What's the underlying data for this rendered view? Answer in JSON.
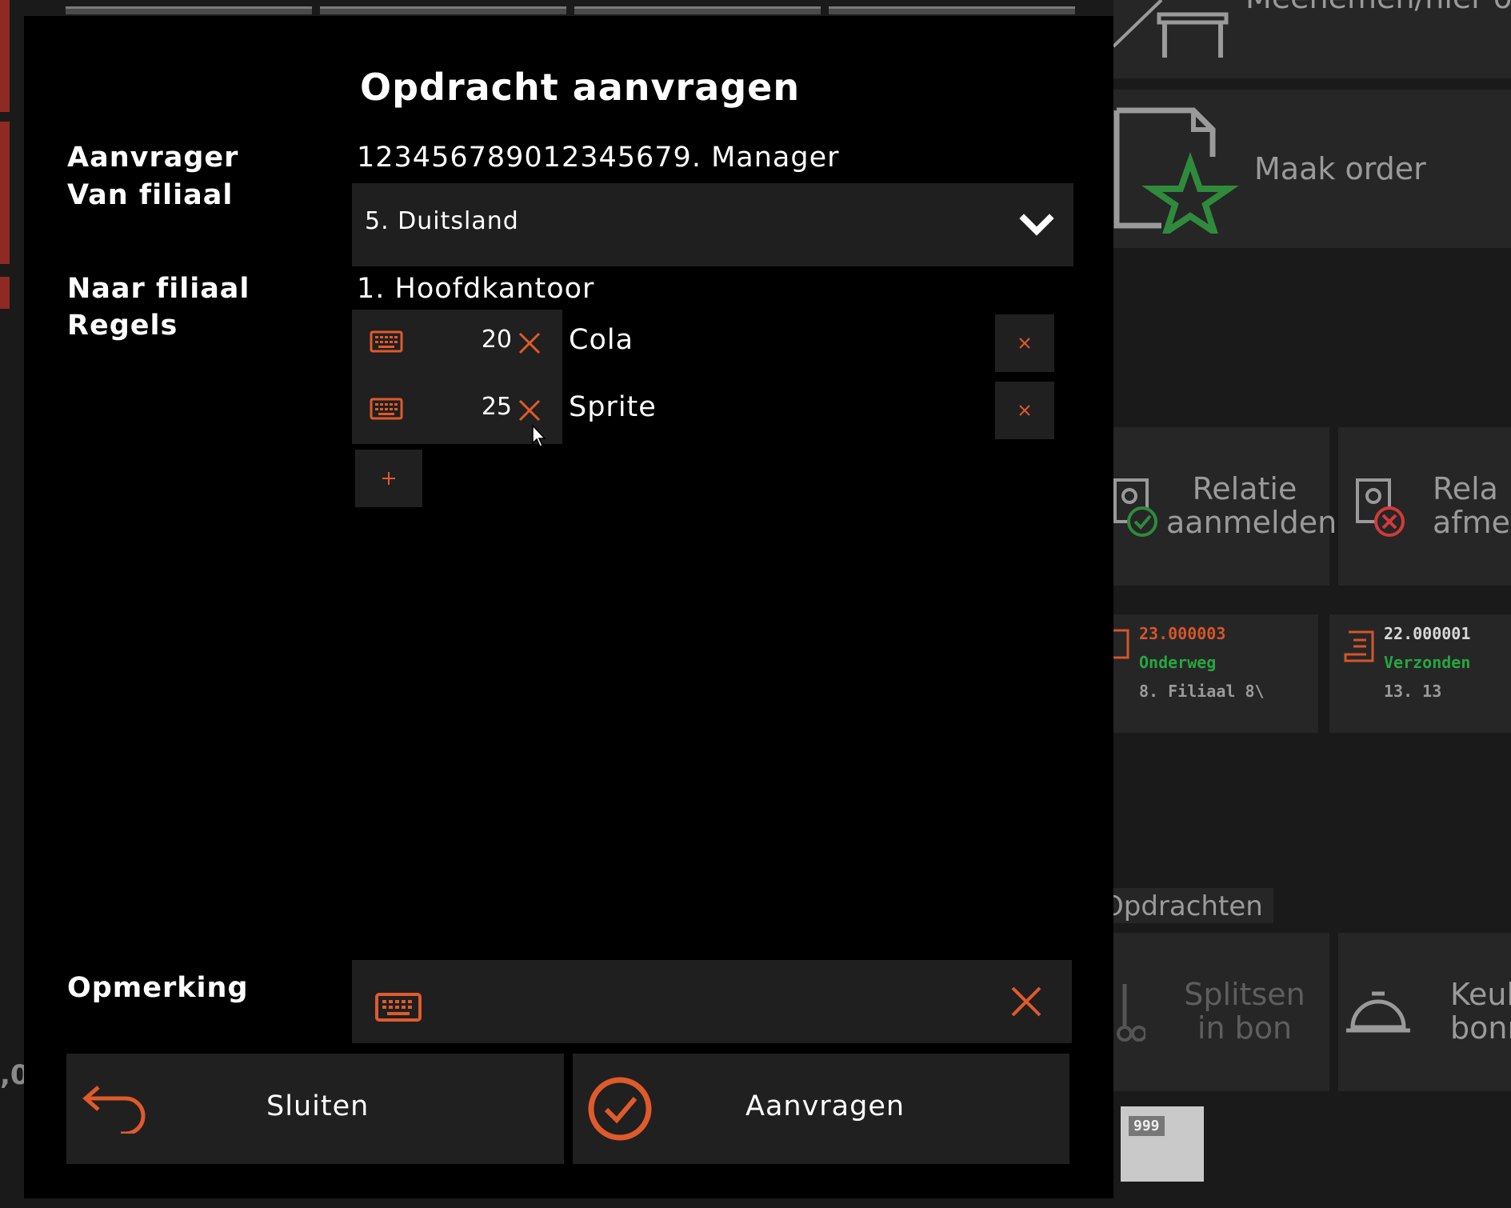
{
  "background": {
    "tiles": {
      "takeaway_label": "Meenemen/hier op",
      "make_order_label": "Maak order",
      "relation_login_label": "Relatie aanmelden",
      "relation_logout_label": "Rela afmel",
      "tab_label": "Opdrachten",
      "split_label": "Splitsen in bon",
      "kitchen_label": "Keuk bonn",
      "badge_label": "999",
      "edge_value": ",0"
    },
    "order_cards": [
      {
        "number": "23.000003",
        "status": "Onderweg",
        "branch": "8. Filiaal 8\\"
      },
      {
        "number": "22.000001",
        "status": "Verzonden",
        "branch": "13. 13"
      }
    ]
  },
  "dialog": {
    "title": "Opdracht aanvragen",
    "requester_label": "Aanvrager",
    "requester_value": "123456789012345679. Manager",
    "from_branch_label": "Van filiaal",
    "from_branch_value": "5. Duitsland",
    "to_branch_label": "Naar filiaal",
    "to_branch_value": "1. Hoofdkantoor",
    "lines_label": "Regels",
    "lines": [
      {
        "qty": "20",
        "name": "Cola"
      },
      {
        "qty": "25",
        "name": "Sprite"
      }
    ],
    "add_line_symbol": "+",
    "remark_label": "Opmerking",
    "remark_value": "",
    "close_label": "Sluiten",
    "submit_label": "Aanvragen"
  },
  "colors": {
    "accent": "#e05a2b",
    "dialog_bg": "#000000",
    "field_bg": "#1f1f1f",
    "status_green": "#27a640",
    "alert_red": "#d23b3b"
  }
}
